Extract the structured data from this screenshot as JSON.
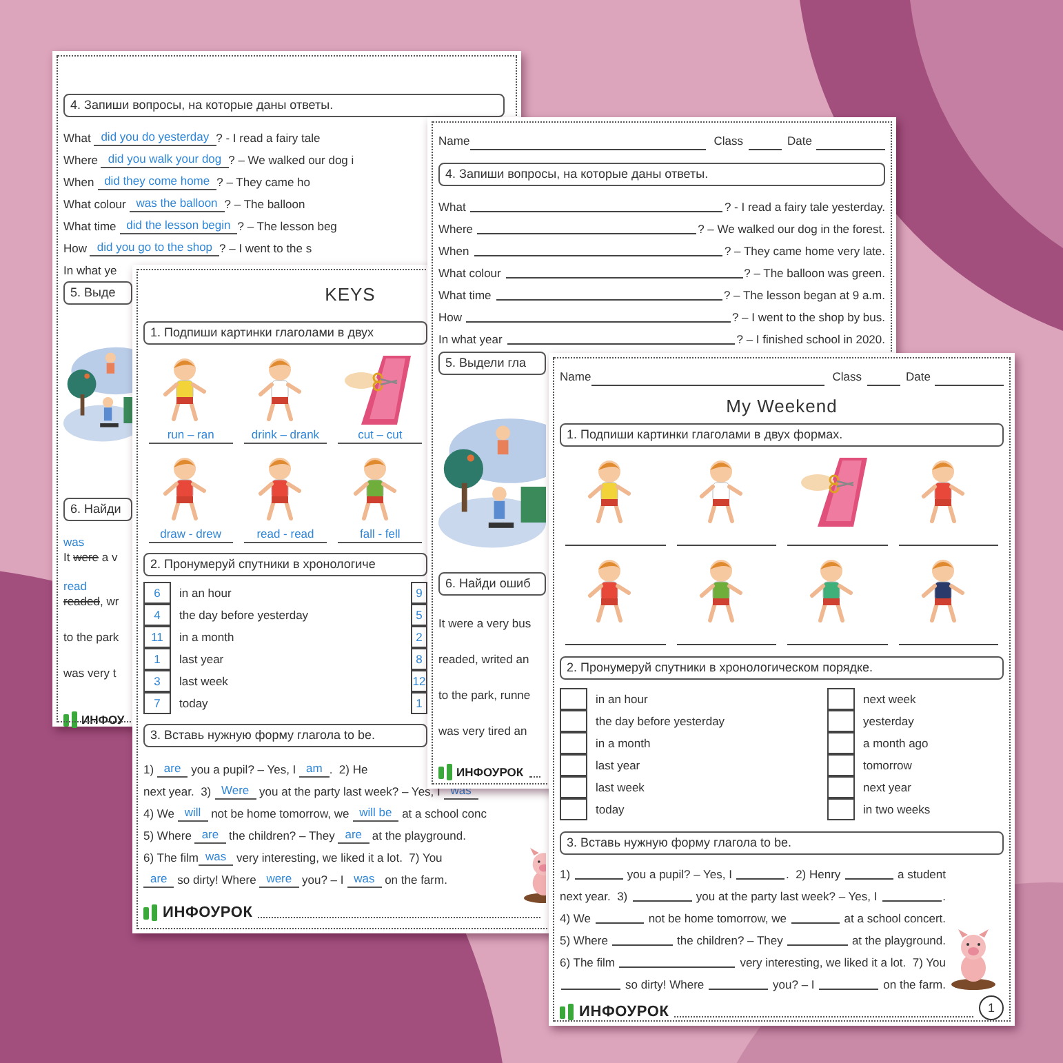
{
  "pages": [
    {
      "blocks": [
        {
          "kind": "task",
          "text": "4. Запиши вопросы, на которые даны ответы."
        },
        {
          "kind": "qa",
          "lines": [
            {
              "parts": [
                {
                  "kind": "text",
                  "text": "What "
                },
                {
                  "kind": "answer",
                  "text": "did you do yesterday"
                },
                {
                  "kind": "text",
                  "text": "? - I read a fairy tale"
                }
              ]
            },
            {
              "parts": [
                {
                  "kind": "text",
                  "text": "Where "
                },
                {
                  "kind": "answer",
                  "text": "did you walk your dog"
                },
                {
                  "kind": "text",
                  "text": "? – We walked our dog i"
                }
              ]
            },
            {
              "parts": [
                {
                  "kind": "text",
                  "text": "When "
                },
                {
                  "kind": "answer",
                  "text": "did they come home"
                },
                {
                  "kind": "text",
                  "text": "? – They came ho"
                }
              ]
            },
            {
              "parts": [
                {
                  "kind": "text",
                  "text": "What colour "
                },
                {
                  "kind": "answer",
                  "text": "was the balloon"
                },
                {
                  "kind": "text",
                  "text": "? – The balloon"
                }
              ]
            },
            {
              "parts": [
                {
                  "kind": "text",
                  "text": "What time "
                },
                {
                  "kind": "answer",
                  "text": "did the lesson begin"
                },
                {
                  "kind": "text",
                  "text": "? – The lesson beg"
                }
              ]
            },
            {
              "parts": [
                {
                  "kind": "text",
                  "text": "How "
                },
                {
                  "kind": "answer",
                  "text": "did you go to the shop"
                },
                {
                  "kind": "text",
                  "text": "? – I went to the s"
                }
              ]
            }
          ]
        },
        {
          "kind": "qa",
          "lines": [
            {
              "parts": [
                {
                  "kind": "text",
                  "text": "In what ye"
                }
              ]
            }
          ]
        },
        {
          "kind": "task",
          "text": "5. Выде"
        },
        {
          "kind": "illustration"
        },
        {
          "kind": "task",
          "text": "6. Найди"
        },
        {
          "kind": "story",
          "lines": [
            {
              "parts": [
                {
                  "kind": "answer",
                  "text": "was"
                }
              ]
            },
            {
              "parts": [
                {
                  "kind": "text",
                  "text": "It "
                },
                {
                  "kind": "struck",
                  "text": "were"
                },
                {
                  "kind": "text",
                  "text": " a v"
                }
              ]
            },
            {
              "parts": [
                {
                  "kind": "answer",
                  "text": "read"
                }
              ]
            },
            {
              "parts": [
                {
                  "kind": "struck",
                  "text": "readed"
                },
                {
                  "kind": "text",
                  "text": ", wr"
                }
              ]
            },
            {
              "parts": [
                {
                  "kind": "text",
                  "text": "to the park"
                }
              ]
            },
            {
              "parts": [
                {
                  "kind": "text",
                  "text": "was very t"
                }
              ]
            }
          ]
        },
        {
          "kind": "footer",
          "logo": "ИНФОУ"
        }
      ]
    },
    {
      "blocks": [
        {
          "kind": "title",
          "text": "KEYS"
        },
        {
          "kind": "task",
          "text": "1. Подпиши картинки глаголами в двух"
        },
        {
          "kind": "pictures",
          "items": [
            {
              "kind": "answer",
              "text": "run – ran"
            },
            {
              "kind": "answer",
              "text": "drink – drank"
            },
            {
              "kind": "answer",
              "text": "cut – cut"
            },
            {
              "kind": "answer",
              "text": "draw - drew"
            },
            {
              "kind": "answer",
              "text": "read - read"
            },
            {
              "kind": "answer",
              "text": "fall - fell"
            }
          ]
        },
        {
          "kind": "task",
          "text": "2. Пронумеруй спутники в хронологиче"
        },
        {
          "kind": "numbering",
          "left": [
            {
              "number": "6",
              "label": "in an hour"
            },
            {
              "number": "4",
              "label": "the day before yesterday"
            },
            {
              "number": "11",
              "label": "in a month"
            },
            {
              "number": "1",
              "label": "last year"
            },
            {
              "number": "3",
              "label": "last week"
            },
            {
              "number": "7",
              "label": "today"
            }
          ],
          "right": [
            {
              "number": "9"
            },
            {
              "number": "5"
            },
            {
              "number": "2"
            },
            {
              "number": "8"
            },
            {
              "number": "12"
            },
            {
              "number": "1"
            }
          ]
        },
        {
          "kind": "task",
          "text": "3. Вставь нужную форму глагола to be."
        },
        {
          "kind": "qa",
          "lines": [
            {
              "parts": [
                {
                  "kind": "text",
                  "text": "1) "
                },
                {
                  "kind": "answer",
                  "text": "are"
                },
                {
                  "kind": "text",
                  "text": " you a pupil? – Yes, I "
                },
                {
                  "kind": "answer",
                  "text": "am"
                },
                {
                  "kind": "text",
                  "text": ".  2) He"
                }
              ]
            }
          ]
        },
        {
          "kind": "qa",
          "lines": [
            {
              "parts": [
                {
                  "kind": "text",
                  "text": "next year.  3) "
                },
                {
                  "kind": "answer",
                  "text": "Were"
                },
                {
                  "kind": "text",
                  "text": " you at the party last week? – Yes, I "
                },
                {
                  "kind": "answer",
                  "text": "was"
                }
              ]
            },
            {
              "parts": [
                {
                  "kind": "text",
                  "text": "4) We "
                },
                {
                  "kind": "answer",
                  "text": "will"
                },
                {
                  "kind": "text",
                  "text": " not be home tomorrow, we "
                },
                {
                  "kind": "answer",
                  "text": "will be"
                },
                {
                  "kind": "text",
                  "text": " at a school conc"
                }
              ]
            },
            {
              "parts": [
                {
                  "kind": "text",
                  "text": "5) Where "
                },
                {
                  "kind": "answer",
                  "text": "are"
                },
                {
                  "kind": "text",
                  "text": " the children? – They "
                },
                {
                  "kind": "answer",
                  "text": "are"
                },
                {
                  "kind": "text",
                  "text": " at the playground."
                }
              ]
            },
            {
              "parts": [
                {
                  "kind": "text",
                  "text": "6) The film"
                },
                {
                  "kind": "answer",
                  "text": "was"
                },
                {
                  "kind": "text",
                  "text": " very interesting, we liked it a lot.  7) You"
                }
              ]
            },
            {
              "parts": [
                {
                  "kind": "answer",
                  "text": "are"
                },
                {
                  "kind": "text",
                  "text": " so dirty! Where "
                },
                {
                  "kind": "answer",
                  "text": "were"
                },
                {
                  "kind": "text",
                  "text": " you? – I "
                },
                {
                  "kind": "answer",
                  "text": "was"
                },
                {
                  "kind": "text",
                  "text": " on the farm."
                }
              ]
            }
          ]
        },
        {
          "kind": "pig"
        },
        {
          "kind": "footer",
          "logo": "ИНФОУРОК"
        }
      ]
    },
    {
      "blocks": [
        {
          "kind": "header",
          "name": "Name",
          "class": "Class",
          "date": "Date"
        },
        {
          "kind": "task",
          "text": "4. Запиши вопросы, на которые даны ответы."
        },
        {
          "kind": "qa",
          "lines": [
            {
              "parts": [
                {
                  "kind": "text",
                  "text": "What "
                },
                {
                  "kind": "blank"
                },
                {
                  "kind": "text",
                  "text": "? - I read a fairy tale yesterday."
                }
              ]
            },
            {
              "parts": [
                {
                  "kind": "text",
                  "text": "Where "
                },
                {
                  "kind": "blank"
                },
                {
                  "kind": "text",
                  "text": "? – We walked our dog in the forest."
                }
              ]
            },
            {
              "parts": [
                {
                  "kind": "text",
                  "text": "When "
                },
                {
                  "kind": "blank"
                },
                {
                  "kind": "text",
                  "text": "? – They came home very late."
                }
              ]
            },
            {
              "parts": [
                {
                  "kind": "text",
                  "text": "What colour "
                },
                {
                  "kind": "blank"
                },
                {
                  "kind": "text",
                  "text": "? – The balloon was green."
                }
              ]
            },
            {
              "parts": [
                {
                  "kind": "text",
                  "text": "What time "
                },
                {
                  "kind": "blank"
                },
                {
                  "kind": "text",
                  "text": "? – The lesson began at 9 a.m."
                }
              ]
            },
            {
              "parts": [
                {
                  "kind": "text",
                  "text": "How "
                },
                {
                  "kind": "blank"
                },
                {
                  "kind": "text",
                  "text": "? – I went to the shop by bus."
                }
              ]
            },
            {
              "parts": [
                {
                  "kind": "text",
                  "text": "In what year "
                },
                {
                  "kind": "blank"
                },
                {
                  "kind": "text",
                  "text": "? – I finished school in 2020."
                }
              ]
            }
          ]
        },
        {
          "kind": "task",
          "text": "5. Выдели гла"
        },
        {
          "kind": "illustration"
        },
        {
          "kind": "task",
          "text": "6. Найди ошиб"
        },
        {
          "kind": "story",
          "lines": [
            {
              "parts": [
                {
                  "kind": "text",
                  "text": "It were a very bus"
                }
              ]
            },
            {
              "parts": [
                {
                  "kind": "text",
                  "text": "readed, writed an"
                }
              ]
            },
            {
              "parts": [
                {
                  "kind": "text",
                  "text": "to the park, runne"
                }
              ]
            },
            {
              "parts": [
                {
                  "kind": "text",
                  "text": "was very tired an"
                }
              ]
            }
          ]
        },
        {
          "kind": "footer",
          "logo": "ИНФОУРОК"
        }
      ]
    },
    {
      "blocks": [
        {
          "kind": "header",
          "name": "Name",
          "class": "Class",
          "date": "Date"
        },
        {
          "kind": "title",
          "text": "My Weekend"
        },
        {
          "kind": "task",
          "text": "1. Подпиши картинки глаголами в двух формах."
        },
        {
          "kind": "pictures",
          "items": [
            {
              "kind": "blank"
            },
            {
              "kind": "blank"
            },
            {
              "kind": "blank"
            },
            {
              "kind": "blank"
            },
            {
              "kind": "blank"
            },
            {
              "kind": "blank"
            },
            {
              "kind": "blank"
            },
            {
              "kind": "blank"
            }
          ]
        },
        {
          "kind": "task",
          "text": "2. Пронумеруй спутники в хронологическом порядке."
        },
        {
          "kind": "numbering",
          "left": [
            {
              "label": "in an hour"
            },
            {
              "label": "the day before yesterday"
            },
            {
              "label": "in a month"
            },
            {
              "label": "last year"
            },
            {
              "label": "last week"
            },
            {
              "label": "today"
            }
          ],
          "right": [
            {
              "label": "next week"
            },
            {
              "label": "yesterday"
            },
            {
              "label": "a month ago"
            },
            {
              "label": "tomorrow"
            },
            {
              "label": "next year"
            },
            {
              "label": "in two weeks"
            }
          ]
        },
        {
          "kind": "task",
          "text": "3. Вставь нужную форму глагола to be."
        },
        {
          "kind": "qa",
          "lines": [
            {
              "parts": [
                {
                  "kind": "text",
                  "text": "1) "
                },
                {
                  "kind": "blank"
                },
                {
                  "kind": "text",
                  "text": " you a pupil? – Yes, I "
                },
                {
                  "kind": "blank"
                },
                {
                  "kind": "text",
                  "text": ".  2) Henry "
                },
                {
                  "kind": "blank"
                },
                {
                  "kind": "text",
                  "text": " a student"
                }
              ]
            },
            {
              "parts": [
                {
                  "kind": "text",
                  "text": "next year.  3) "
                },
                {
                  "kind": "blank"
                },
                {
                  "kind": "text",
                  "text": " you at the party last week? – Yes, I "
                },
                {
                  "kind": "blank"
                },
                {
                  "kind": "text",
                  "text": "."
                }
              ]
            },
            {
              "parts": [
                {
                  "kind": "text",
                  "text": "4) We "
                },
                {
                  "kind": "blank"
                },
                {
                  "kind": "text",
                  "text": " not be home tomorrow, we "
                },
                {
                  "kind": "blank"
                },
                {
                  "kind": "text",
                  "text": " at a school concert."
                }
              ]
            },
            {
              "parts": [
                {
                  "kind": "text",
                  "text": "5) Where "
                },
                {
                  "kind": "blank"
                },
                {
                  "kind": "text",
                  "text": " the children? – They "
                },
                {
                  "kind": "blank"
                },
                {
                  "kind": "text",
                  "text": " at the playground."
                }
              ]
            },
            {
              "parts": [
                {
                  "kind": "text",
                  "text": "6) The film "
                },
                {
                  "kind": "blank"
                },
                {
                  "kind": "text",
                  "text": " very interesting, we liked it a lot.  7) You"
                }
              ]
            },
            {
              "parts": [
                {
                  "kind": "blank"
                },
                {
                  "kind": "text",
                  "text": " so dirty! Where "
                },
                {
                  "kind": "blank"
                },
                {
                  "kind": "text",
                  "text": " you? – I "
                },
                {
                  "kind": "blank"
                },
                {
                  "kind": "text",
                  "text": " on the farm."
                }
              ]
            }
          ]
        },
        {
          "kind": "pig"
        },
        {
          "kind": "footer",
          "logo": "ИНФОУРОК",
          "page_number": "1"
        }
      ]
    }
  ]
}
